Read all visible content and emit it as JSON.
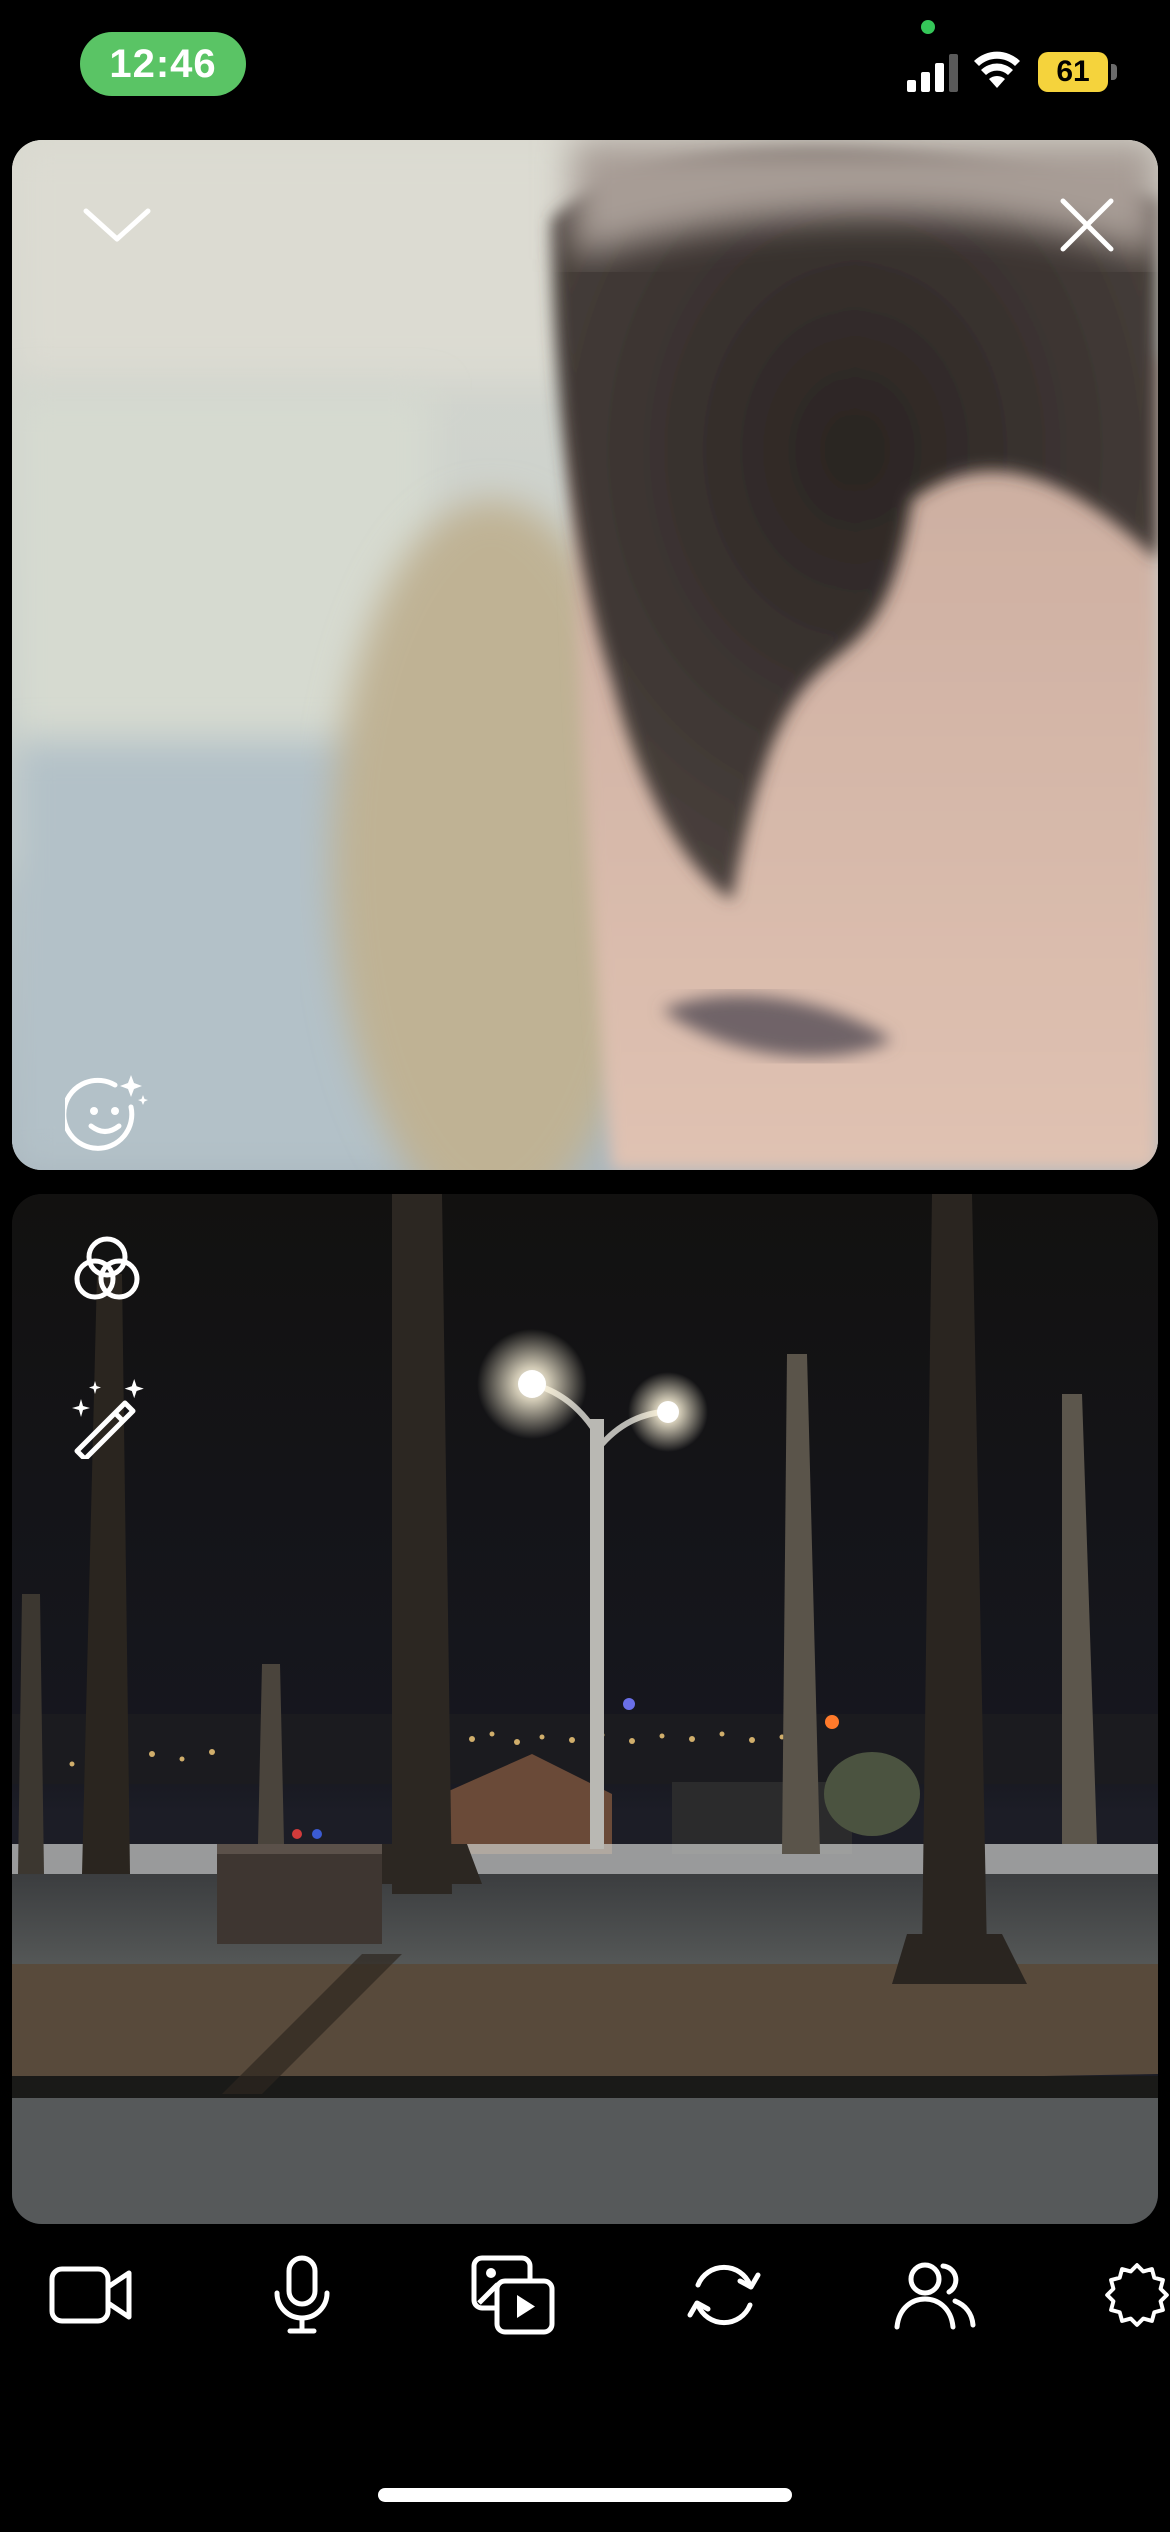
{
  "status_bar": {
    "time": "12:46",
    "battery_level": "61",
    "time_pill_color": "#5ac465",
    "battery_color": "#f5d33c",
    "camera_indicator_color": "#35c759"
  },
  "remote_video": {
    "collapse_icon": "chevron-down-icon",
    "close_icon": "close-icon",
    "effects_icon": "face-sparkle-icon"
  },
  "local_video": {
    "filters_icon": "filters-icon",
    "beauty_icon": "magic-wand-icon"
  },
  "toolbar": {
    "items": [
      "video-camera-icon",
      "microphone-icon",
      "media-share-icon",
      "flip-camera-icon",
      "participants-icon",
      "settings-icon"
    ]
  }
}
